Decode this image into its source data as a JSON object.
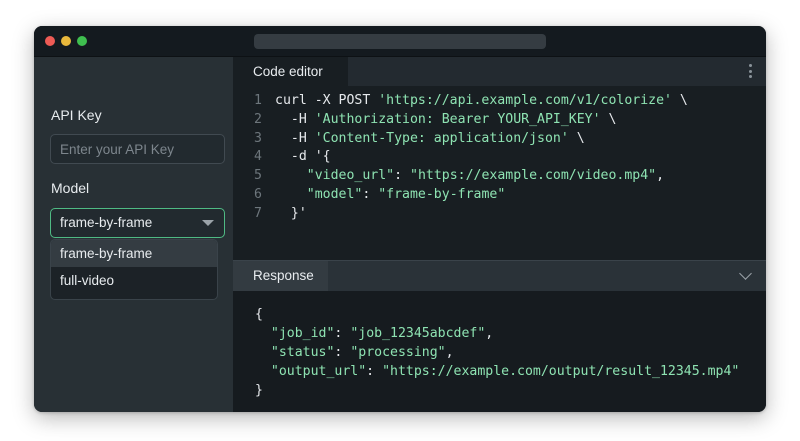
{
  "colors": {
    "accent_green": "#4fba84",
    "string_green": "#8ee3b2",
    "window_bg": "#232a30",
    "close": "#ee5b55",
    "minimize": "#e9b83c",
    "maximize": "#3fbf4f"
  },
  "sidebar": {
    "api_key_label": "API Key",
    "api_key_placeholder": "Enter your API Key",
    "api_key_value": "",
    "model_label": "Model",
    "model_selected": "frame-by-frame",
    "model_options": [
      "frame-by-frame",
      "full-video"
    ]
  },
  "editor": {
    "tab_label": "Code editor",
    "menu_icon": "kebab-icon",
    "lines": [
      {
        "n": "1",
        "pre": "curl -X POST ",
        "str": "'https://api.example.com/v1/colorize'",
        "post": " \\"
      },
      {
        "n": "2",
        "pre": "  -H ",
        "str": "'Authorization: Bearer YOUR_API_KEY'",
        "post": " \\"
      },
      {
        "n": "3",
        "pre": "  -H ",
        "str": "'Content-Type: application/json'",
        "post": " \\"
      },
      {
        "n": "4",
        "pre": "  -d '{",
        "str": "",
        "post": ""
      },
      {
        "n": "5",
        "pre": "    ",
        "str": "\"video_url\"",
        "post": ": ",
        "str2": "\"https://example.com/video.mp4\"",
        "post2": ","
      },
      {
        "n": "6",
        "pre": "    ",
        "str": "\"model\"",
        "post": ": ",
        "str2": "\"frame-by-frame\"",
        "post2": ""
      },
      {
        "n": "7",
        "pre": "  }'",
        "str": "",
        "post": ""
      }
    ]
  },
  "response": {
    "tab_label": "Response",
    "collapse_icon": "chevron-down-icon",
    "lines": [
      {
        "pre": "{",
        "str": "",
        "post": ""
      },
      {
        "pre": "  ",
        "str": "\"job_id\"",
        "post": ": ",
        "str2": "\"job_12345abcdef\"",
        "post2": ","
      },
      {
        "pre": "  ",
        "str": "\"status\"",
        "post": ": ",
        "str2": "\"processing\"",
        "post2": ","
      },
      {
        "pre": "  ",
        "str": "\"output_url\"",
        "post": ": ",
        "str2": "\"https://example.com/output/result_12345.mp4\"",
        "post2": ""
      },
      {
        "pre": "}",
        "str": "",
        "post": ""
      }
    ]
  }
}
